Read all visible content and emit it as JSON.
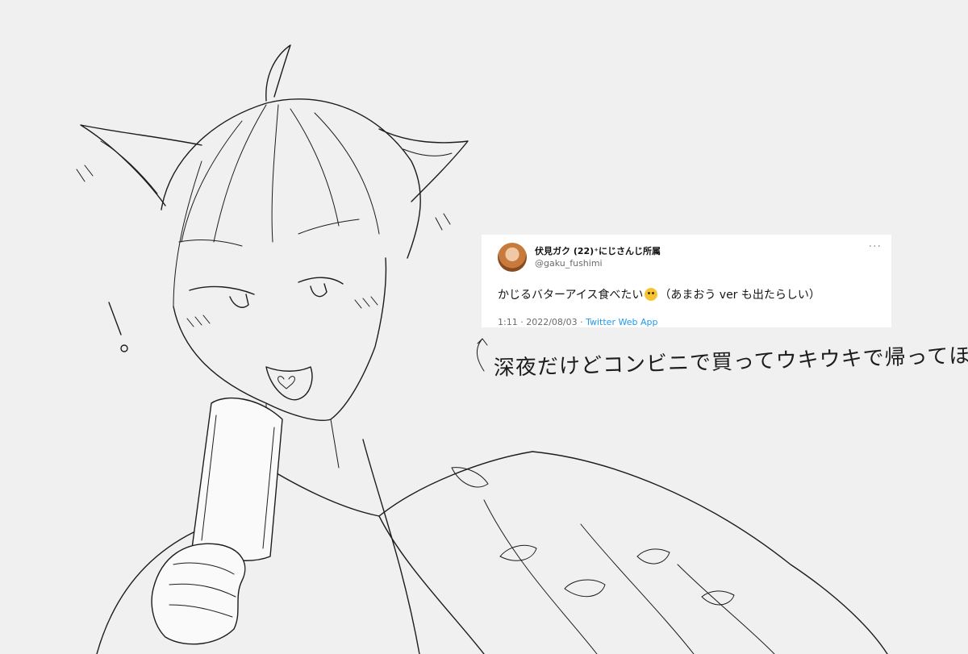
{
  "tweet": {
    "display_name": "伏見ガク (22)⁺にじさんじ所属",
    "handle": "@gaku_fushimi",
    "text_before_emoji": "かじるバターアイス食べたい",
    "text_after_emoji": "（あまおう ver も出たらしい）",
    "time": "1:11",
    "date": "2022/08/03",
    "source": "Twitter Web App",
    "separator": "·",
    "emoji_icon": "rolling-eyes-face-icon",
    "more_icon": "ellipsis-icon"
  },
  "handwritten_note": "深夜だけどコンビニで買ってウキウキで帰ってほしい",
  "colors": {
    "background": "#f0f0f0",
    "line": "#1c1c1c",
    "link": "#1d9bf0"
  }
}
